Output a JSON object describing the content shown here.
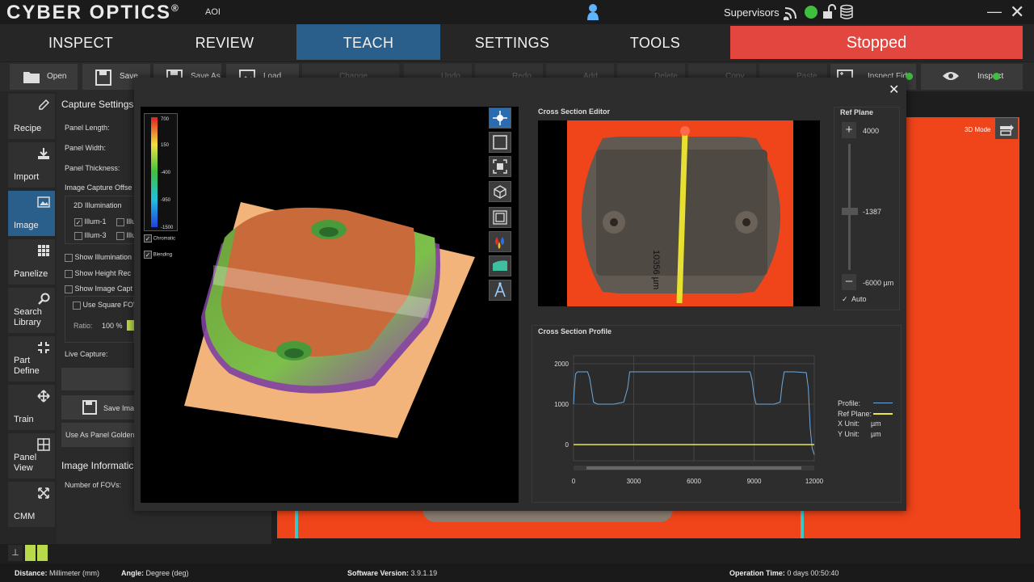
{
  "app": {
    "logo": "CYBER OPTICS",
    "logo_reg": "®",
    "logo_sub": "AOI",
    "user": "Supervisors"
  },
  "tabs": [
    {
      "label": "INSPECT"
    },
    {
      "label": "REVIEW"
    },
    {
      "label": "TEACH",
      "active": true
    },
    {
      "label": "SETTINGS"
    },
    {
      "label": "TOOLS"
    }
  ],
  "status": {
    "label": "Stopped",
    "color": "#e2463f"
  },
  "toolbar": {
    "open": "Open",
    "save": "Save",
    "save_as": "Save As",
    "load_image": "Load Image",
    "change_template": "Change Template",
    "undo": "Undo",
    "redo": "Redo",
    "add": "Add",
    "delete": "Delete",
    "copy": "Copy",
    "paste": "Paste",
    "inspect_fids": "Inspect Fids",
    "inspect": "Inspect"
  },
  "sidebar": [
    {
      "label": "Recipe",
      "icon": "pencil-icon"
    },
    {
      "label": "Import",
      "icon": "import-icon"
    },
    {
      "label": "Image",
      "icon": "image-icon",
      "active": true
    },
    {
      "label": "Panelize",
      "icon": "grid-icon"
    },
    {
      "label": "Search Library",
      "icon": "search-icon"
    },
    {
      "label": "Part Define",
      "icon": "part-define-icon"
    },
    {
      "label": "Train",
      "icon": "move-icon"
    },
    {
      "label": "Panel View",
      "icon": "panel-view-icon"
    },
    {
      "label": "CMM",
      "icon": "cmm-icon"
    }
  ],
  "capture": {
    "title": "Capture Settings",
    "panel_length": "Panel Length:",
    "panel_width": "Panel Width:",
    "panel_thickness": "Panel Thickness:",
    "image_capture_offset": "Image Capture Offse",
    "illum_group": "2D Illumination",
    "illum1": "Illum-1",
    "illum3": "Illum-3",
    "illum2": "Illu",
    "illum4": "Illu",
    "show_illumination": "Show Illumination",
    "show_height": "Show Height Rec",
    "show_image_capture": "Show Image Capt",
    "use_square_fov": "Use Square FOV",
    "ratio_label": "Ratio:",
    "ratio_value": "100 %",
    "live_capture": "Live Capture:",
    "save_image": "Save Ima",
    "use_as_golden": "Use As Panel Golden",
    "image_information": "Image Informatic",
    "number_of_fovs": "Number of FOVs:",
    "colon": ":"
  },
  "view3d": {
    "scale_labels": [
      "700",
      "150",
      "-400",
      "-950",
      "-1500"
    ],
    "chromatic": "Chromatic",
    "blending": "Blending"
  },
  "cross_section": {
    "editor_title": "Cross Section Editor",
    "measure_label": "10356 µm",
    "ref_plane_title": "Ref Plane",
    "ref_top": "4000",
    "ref_mid": "-1387",
    "ref_bottom": "-6000 µm",
    "auto": "Auto"
  },
  "right_image": {
    "mode_label": "3D Mode"
  },
  "chart_data": {
    "type": "line",
    "title": "Cross Section Profile",
    "x_ticks": [
      "0",
      "3000",
      "6000",
      "9000",
      "12000"
    ],
    "y_ticks": [
      "2000",
      "1000",
      "0"
    ],
    "xlim": [
      0,
      12000
    ],
    "ylim": [
      -400,
      2200
    ],
    "grid": true,
    "series": [
      {
        "name": "Profile",
        "color": "#6fa8dc",
        "x": [
          0,
          40,
          100,
          200,
          700,
          800,
          1000,
          1200,
          1500,
          2000,
          2500,
          2700,
          2800,
          3000,
          6000,
          8800,
          8900,
          9000,
          9100,
          9500,
          10000,
          10300,
          10400,
          10500,
          11000,
          11600,
          11700,
          11800,
          11900,
          12000
        ],
        "y": [
          1000,
          1380,
          1750,
          1800,
          1800,
          1650,
          1050,
          1000,
          1000,
          1000,
          1050,
          1400,
          1800,
          1800,
          1800,
          1800,
          1600,
          1200,
          1000,
          1000,
          1000,
          1050,
          1500,
          1800,
          1800,
          1780,
          1400,
          400,
          -100,
          -250
        ]
      },
      {
        "name": "Ref Plane",
        "color": "#e8e84a",
        "x": [
          0,
          12000
        ],
        "y": [
          0,
          0
        ]
      }
    ],
    "legend": {
      "profile": "Profile:",
      "ref_plane": "Ref Plane:",
      "x_unit_label": "X Unit:",
      "x_unit": "µm",
      "y_unit_label": "Y Unit:",
      "y_unit": "µm"
    }
  },
  "statusbar": {
    "distance_label": "Distance:",
    "distance_value": "Millimeter (mm)",
    "angle_label": "Angle:",
    "angle_value": "Degree (deg)",
    "software_label": "Software Version:",
    "software_value": "3.9.1.19",
    "operation_label": "Operation Time:",
    "operation_value": "0 days 00:50:40"
  }
}
